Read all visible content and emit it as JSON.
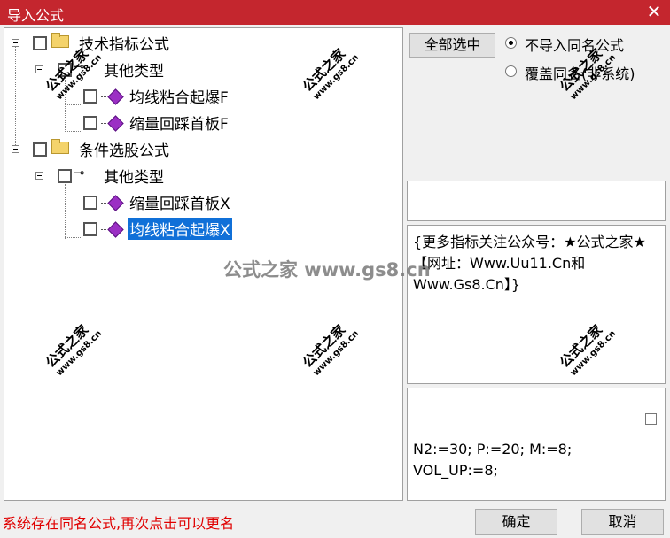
{
  "window": {
    "title": "导入公式",
    "close_glyph": "✕"
  },
  "tree": {
    "group1": {
      "label": "技术指标公式",
      "child": {
        "label": "其他类型",
        "items": [
          "均线粘合起爆F",
          "缩量回踩首板F"
        ]
      }
    },
    "group2": {
      "label": "条件选股公式",
      "child": {
        "label": "其他类型",
        "items": [
          "缩量回踩首板X",
          "均线粘合起爆X"
        ]
      }
    },
    "selected": "均线粘合起爆X"
  },
  "options": {
    "select_all_label": "全部选中",
    "radio1": "不导入同名公式",
    "radio2": "覆盖同名(非系统)"
  },
  "description": "{更多指标关注公众号：★公式之家★ 【网址：Www.Uu11.Cn和Www.Gs8.Cn】}",
  "code": "N2:=30; P:=20; M:=8;\nVOL_UP:=8;",
  "status": "系统存在同名公式,再次点击可以更名",
  "buttons": {
    "ok": "确定",
    "cancel": "取消"
  },
  "watermark": {
    "cn": "公式之家",
    "url": "www.gs8.cn",
    "center": "公式之家 www.gs8.cn"
  }
}
